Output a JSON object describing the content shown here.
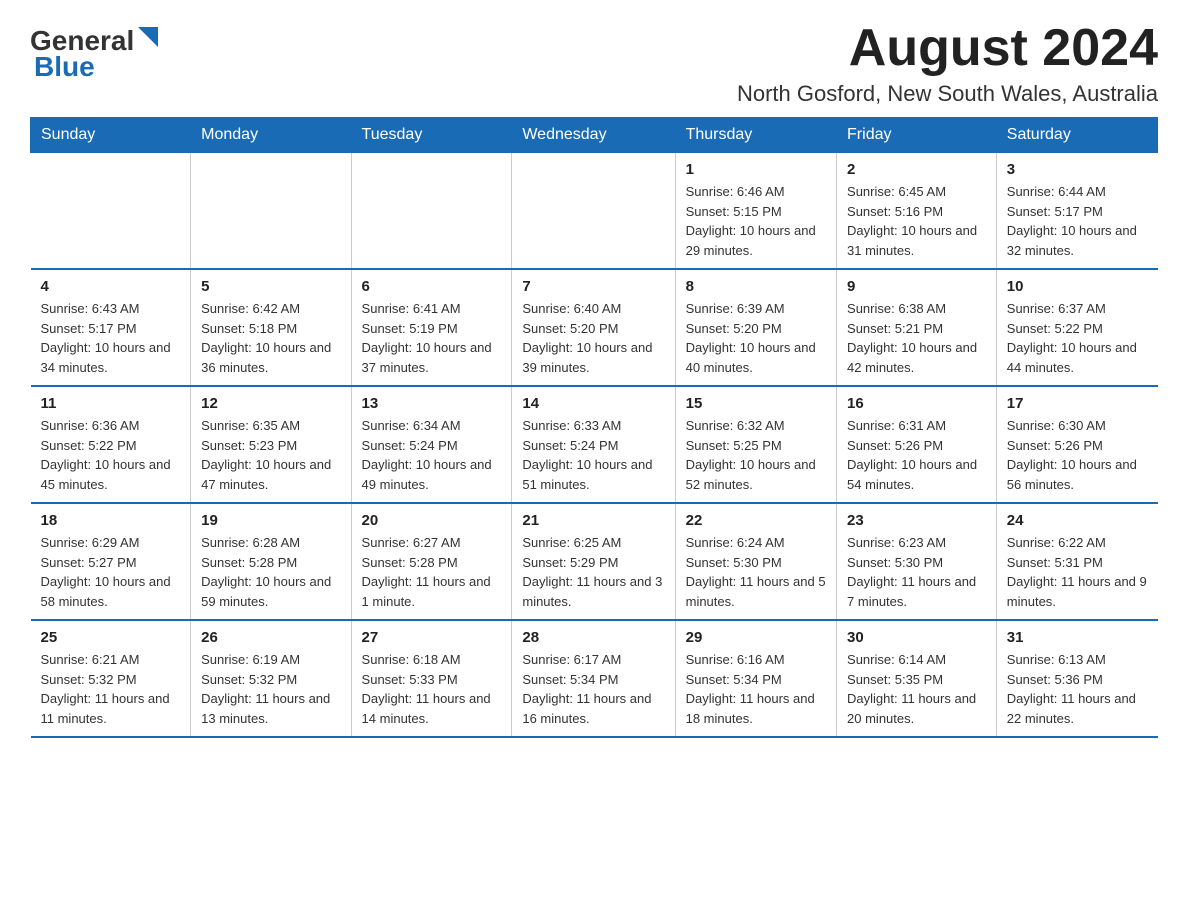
{
  "header": {
    "logo_general": "General",
    "logo_blue": "Blue",
    "month_title": "August 2024",
    "location": "North Gosford, New South Wales, Australia"
  },
  "calendar": {
    "days_of_week": [
      "Sunday",
      "Monday",
      "Tuesday",
      "Wednesday",
      "Thursday",
      "Friday",
      "Saturday"
    ],
    "weeks": [
      [
        {
          "day": "",
          "info": ""
        },
        {
          "day": "",
          "info": ""
        },
        {
          "day": "",
          "info": ""
        },
        {
          "day": "",
          "info": ""
        },
        {
          "day": "1",
          "info": "Sunrise: 6:46 AM\nSunset: 5:15 PM\nDaylight: 10 hours and 29 minutes."
        },
        {
          "day": "2",
          "info": "Sunrise: 6:45 AM\nSunset: 5:16 PM\nDaylight: 10 hours and 31 minutes."
        },
        {
          "day": "3",
          "info": "Sunrise: 6:44 AM\nSunset: 5:17 PM\nDaylight: 10 hours and 32 minutes."
        }
      ],
      [
        {
          "day": "4",
          "info": "Sunrise: 6:43 AM\nSunset: 5:17 PM\nDaylight: 10 hours and 34 minutes."
        },
        {
          "day": "5",
          "info": "Sunrise: 6:42 AM\nSunset: 5:18 PM\nDaylight: 10 hours and 36 minutes."
        },
        {
          "day": "6",
          "info": "Sunrise: 6:41 AM\nSunset: 5:19 PM\nDaylight: 10 hours and 37 minutes."
        },
        {
          "day": "7",
          "info": "Sunrise: 6:40 AM\nSunset: 5:20 PM\nDaylight: 10 hours and 39 minutes."
        },
        {
          "day": "8",
          "info": "Sunrise: 6:39 AM\nSunset: 5:20 PM\nDaylight: 10 hours and 40 minutes."
        },
        {
          "day": "9",
          "info": "Sunrise: 6:38 AM\nSunset: 5:21 PM\nDaylight: 10 hours and 42 minutes."
        },
        {
          "day": "10",
          "info": "Sunrise: 6:37 AM\nSunset: 5:22 PM\nDaylight: 10 hours and 44 minutes."
        }
      ],
      [
        {
          "day": "11",
          "info": "Sunrise: 6:36 AM\nSunset: 5:22 PM\nDaylight: 10 hours and 45 minutes."
        },
        {
          "day": "12",
          "info": "Sunrise: 6:35 AM\nSunset: 5:23 PM\nDaylight: 10 hours and 47 minutes."
        },
        {
          "day": "13",
          "info": "Sunrise: 6:34 AM\nSunset: 5:24 PM\nDaylight: 10 hours and 49 minutes."
        },
        {
          "day": "14",
          "info": "Sunrise: 6:33 AM\nSunset: 5:24 PM\nDaylight: 10 hours and 51 minutes."
        },
        {
          "day": "15",
          "info": "Sunrise: 6:32 AM\nSunset: 5:25 PM\nDaylight: 10 hours and 52 minutes."
        },
        {
          "day": "16",
          "info": "Sunrise: 6:31 AM\nSunset: 5:26 PM\nDaylight: 10 hours and 54 minutes."
        },
        {
          "day": "17",
          "info": "Sunrise: 6:30 AM\nSunset: 5:26 PM\nDaylight: 10 hours and 56 minutes."
        }
      ],
      [
        {
          "day": "18",
          "info": "Sunrise: 6:29 AM\nSunset: 5:27 PM\nDaylight: 10 hours and 58 minutes."
        },
        {
          "day": "19",
          "info": "Sunrise: 6:28 AM\nSunset: 5:28 PM\nDaylight: 10 hours and 59 minutes."
        },
        {
          "day": "20",
          "info": "Sunrise: 6:27 AM\nSunset: 5:28 PM\nDaylight: 11 hours and 1 minute."
        },
        {
          "day": "21",
          "info": "Sunrise: 6:25 AM\nSunset: 5:29 PM\nDaylight: 11 hours and 3 minutes."
        },
        {
          "day": "22",
          "info": "Sunrise: 6:24 AM\nSunset: 5:30 PM\nDaylight: 11 hours and 5 minutes."
        },
        {
          "day": "23",
          "info": "Sunrise: 6:23 AM\nSunset: 5:30 PM\nDaylight: 11 hours and 7 minutes."
        },
        {
          "day": "24",
          "info": "Sunrise: 6:22 AM\nSunset: 5:31 PM\nDaylight: 11 hours and 9 minutes."
        }
      ],
      [
        {
          "day": "25",
          "info": "Sunrise: 6:21 AM\nSunset: 5:32 PM\nDaylight: 11 hours and 11 minutes."
        },
        {
          "day": "26",
          "info": "Sunrise: 6:19 AM\nSunset: 5:32 PM\nDaylight: 11 hours and 13 minutes."
        },
        {
          "day": "27",
          "info": "Sunrise: 6:18 AM\nSunset: 5:33 PM\nDaylight: 11 hours and 14 minutes."
        },
        {
          "day": "28",
          "info": "Sunrise: 6:17 AM\nSunset: 5:34 PM\nDaylight: 11 hours and 16 minutes."
        },
        {
          "day": "29",
          "info": "Sunrise: 6:16 AM\nSunset: 5:34 PM\nDaylight: 11 hours and 18 minutes."
        },
        {
          "day": "30",
          "info": "Sunrise: 6:14 AM\nSunset: 5:35 PM\nDaylight: 11 hours and 20 minutes."
        },
        {
          "day": "31",
          "info": "Sunrise: 6:13 AM\nSunset: 5:36 PM\nDaylight: 11 hours and 22 minutes."
        }
      ]
    ]
  }
}
